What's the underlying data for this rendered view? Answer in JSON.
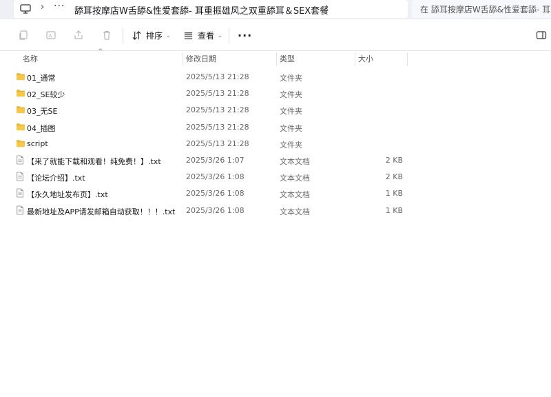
{
  "address_bar": {
    "separator": "›",
    "more": "···",
    "path": "舔耳按摩店W舌舔&性爱套舔- 耳重振雄风之双重舔耳＆SEX套餐",
    "search_text": "在 舔耳按摩店W舌舔&性爱套舔- 耳"
  },
  "command_bar": {
    "sort_label": "排序",
    "view_label": "查看",
    "more_label": "···"
  },
  "columns": {
    "name": "名称",
    "date": "修改日期",
    "type": "类型",
    "size": "大小"
  },
  "files": [
    {
      "name": "01_通常",
      "date": "2025/5/13 21:28",
      "type": "文件夹",
      "size": "",
      "kind": "folder-icon"
    },
    {
      "name": "02_SE较少",
      "date": "2025/5/13 21:28",
      "type": "文件夹",
      "size": "",
      "kind": "folder-icon"
    },
    {
      "name": "03_无SE",
      "date": "2025/5/13 21:28",
      "type": "文件夹",
      "size": "",
      "kind": "folder-icon"
    },
    {
      "name": "04_插图",
      "date": "2025/5/13 21:28",
      "type": "文件夹",
      "size": "",
      "kind": "folder-icon"
    },
    {
      "name": "script",
      "date": "2025/5/13 21:28",
      "type": "文件夹",
      "size": "",
      "kind": "folder-icon"
    },
    {
      "name": "【来了就能下载和观看！纯免费！】.txt",
      "date": "2025/3/26 1:07",
      "type": "文本文档",
      "size": "2 KB",
      "kind": "text-file-icon"
    },
    {
      "name": "【论坛介绍】.txt",
      "date": "2025/3/26 1:08",
      "type": "文本文档",
      "size": "2 KB",
      "kind": "text-file-icon"
    },
    {
      "name": "【永久地址发布页】.txt",
      "date": "2025/3/26 1:08",
      "type": "文本文档",
      "size": "1 KB",
      "kind": "text-file-icon"
    },
    {
      "name": "最新地址及APP请发邮箱自动获取！！！.txt",
      "date": "2025/3/26 1:08",
      "type": "文本文档",
      "size": "1 KB",
      "kind": "text-file-icon"
    }
  ],
  "colors": {
    "folder": "#f5c84c",
    "folder_dark": "#e9b334",
    "accent": "#1a1a1a"
  }
}
